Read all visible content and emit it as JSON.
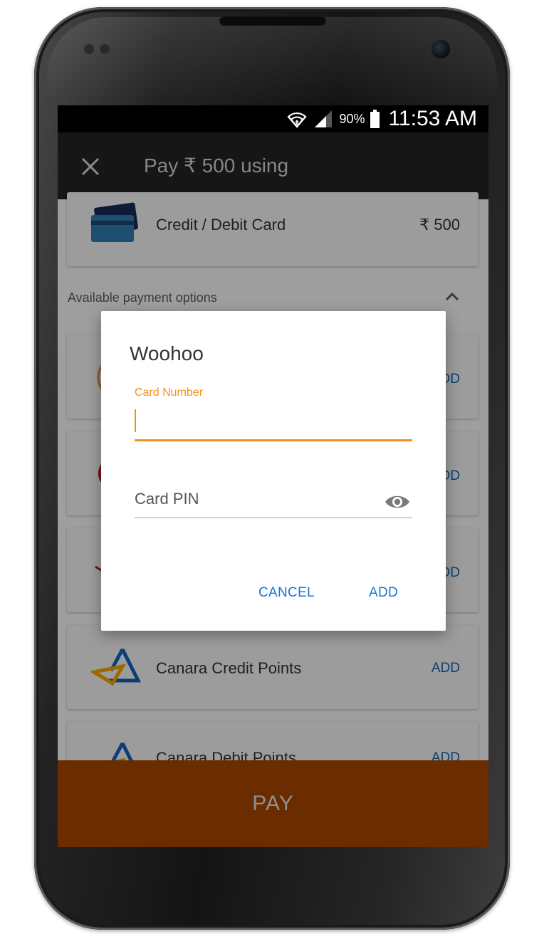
{
  "status_bar": {
    "battery_percent": "90%",
    "time": "11:53 AM"
  },
  "app_bar": {
    "title": "Pay ₹ 500 using"
  },
  "selected_method": {
    "label": "Credit / Debit Card",
    "amount": "₹ 500"
  },
  "section": {
    "label": "Available payment options"
  },
  "payment_options": [
    {
      "label": "Canara Credit Points",
      "action": "ADD"
    },
    {
      "label": "Canara Debit Points",
      "action": "ADD"
    }
  ],
  "partial_actions": [
    "DD",
    "DD",
    "DD"
  ],
  "pay_button": {
    "label": "PAY"
  },
  "dialog": {
    "title": "Woohoo",
    "card_number_label": "Card Number",
    "card_number_value": "",
    "card_pin_placeholder": "Card PIN",
    "cancel_label": "CANCEL",
    "add_label": "ADD"
  },
  "colors": {
    "accent": "#f0921a",
    "dialog_button": "#1976d2",
    "pay_bar": "#6b2d00",
    "app_bar": "#161616"
  }
}
